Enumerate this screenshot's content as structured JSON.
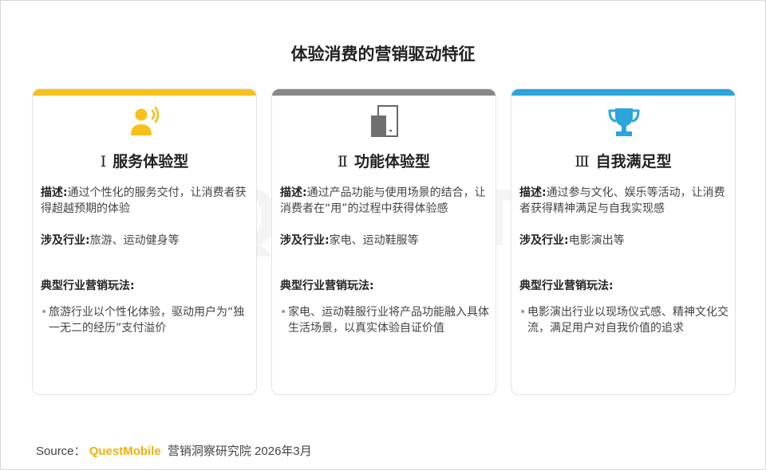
{
  "title": "体验消费的营销驱动特征",
  "watermark": {
    "text": "QUESTMOBILE"
  },
  "labels": {
    "desc": "描述",
    "industry": "涉及行业",
    "play": "典型行业营销玩法:",
    "colon": ":"
  },
  "cards": [
    {
      "accent": "#f6c11a",
      "icon": "person-speaking-icon",
      "numeral": "Ⅰ",
      "type": "服务体验型",
      "desc": "通过个性化的服务交付，让消费者获得超越预期的体验",
      "industry": "旅游、运动健身等",
      "bullet": "旅游行业以个性化体验，驱动用户为“独一无二的经历”支付溢价"
    },
    {
      "accent": "#888888",
      "icon": "device-icon",
      "numeral": "Ⅱ",
      "type": "功能体验型",
      "desc": "通过产品功能与使用场景的结合，让消费者在“用”的过程中获得体验感",
      "industry": "家电、运动鞋服等",
      "bullet": "家电、运动鞋服行业将产品功能融入具体生活场景，以真实体验自证价值"
    },
    {
      "accent": "#2aa6dc",
      "icon": "trophy-icon",
      "numeral": "Ⅲ",
      "type": "自我满足型",
      "desc": "通过参与文化、娱乐等活动，让消费者获得精神满足与自我实现感",
      "industry": "电影演出等",
      "bullet": "电影演出行业以现场仪式感、精神文化交流，满足用户对自我价值的追求"
    }
  ],
  "source": {
    "prefix": "Source：",
    "brand": "QuestMobile",
    "rest": "营销洞察研究院 2026年3月"
  }
}
